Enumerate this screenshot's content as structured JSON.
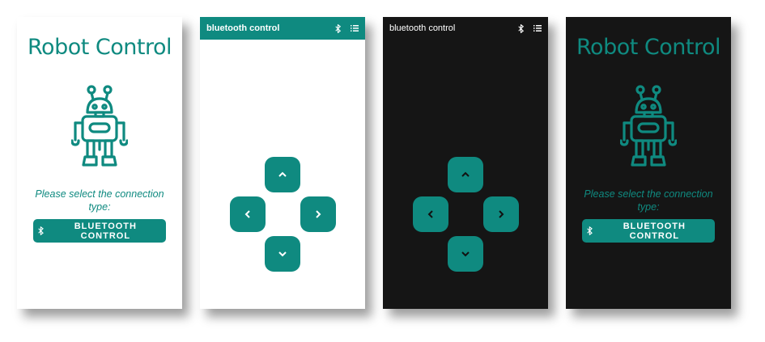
{
  "colors": {
    "accent": "#0f8a80",
    "dark_bg": "#151515",
    "light_bg": "#ffffff"
  },
  "screens": [
    {
      "theme": "light",
      "title": "Robot Control",
      "robot_icon": "robot-icon",
      "prompt": "Please select the connection type:",
      "button": {
        "label": "BLUETOOTH CONTROL",
        "icon": "bluetooth-icon"
      }
    },
    {
      "theme": "light",
      "appbar": {
        "title": "bluetooth control",
        "icons": [
          "bluetooth-icon",
          "list-icon"
        ]
      },
      "dpad": [
        "chevron-up-icon",
        "chevron-left-icon",
        "chevron-right-icon",
        "chevron-down-icon"
      ]
    },
    {
      "theme": "dark",
      "appbar": {
        "title": "bluetooth control",
        "icons": [
          "bluetooth-icon",
          "list-icon"
        ]
      },
      "dpad": [
        "chevron-up-icon",
        "chevron-left-icon",
        "chevron-right-icon",
        "chevron-down-icon"
      ]
    },
    {
      "theme": "dark",
      "title": "Robot Control",
      "robot_icon": "robot-icon",
      "prompt": "Please select the connection type:",
      "button": {
        "label": "BLUETOOTH CONTROL",
        "icon": "bluetooth-icon"
      }
    }
  ]
}
